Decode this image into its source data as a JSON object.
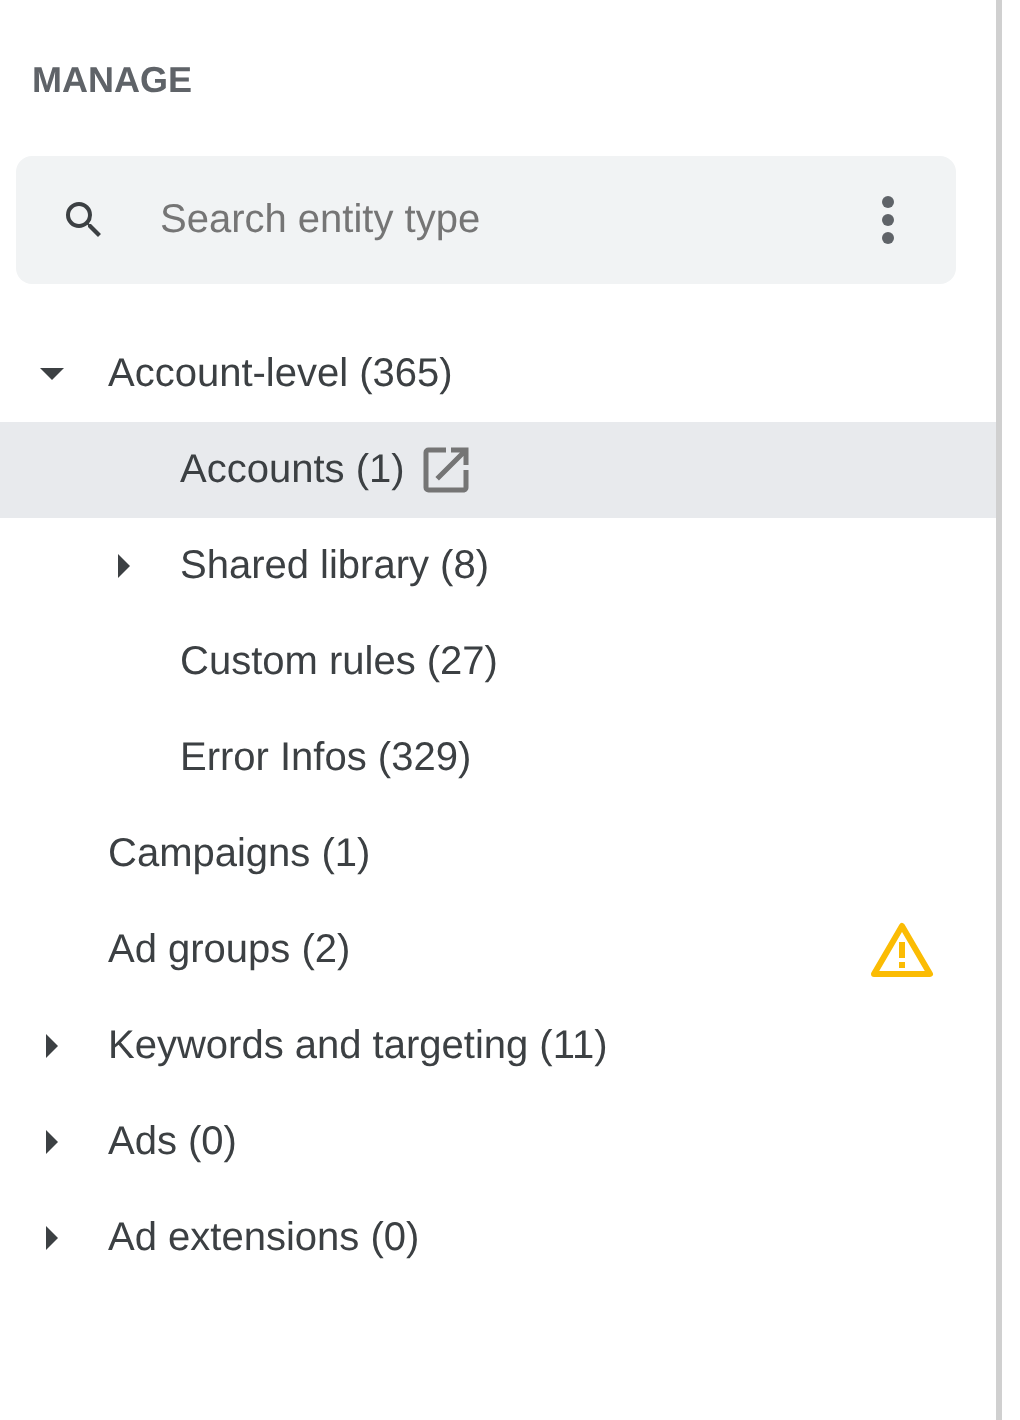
{
  "heading": "MANAGE",
  "search": {
    "placeholder": "Search entity type"
  },
  "tree": [
    {
      "label": "Account-level (365)",
      "kind": "folder",
      "expanded": true,
      "selected": false,
      "children": [
        {
          "label": "Accounts (1)",
          "kind": "leaf",
          "selected": true,
          "link": true
        },
        {
          "label": "Shared library (8)",
          "kind": "folder",
          "expanded": false,
          "selected": false
        },
        {
          "label": "Custom rules (27)",
          "kind": "leaf",
          "selected": false
        },
        {
          "label": "Error Infos (329)",
          "kind": "leaf",
          "selected": false
        }
      ]
    },
    {
      "label": "Campaigns (1)",
      "kind": "leaf",
      "selected": false
    },
    {
      "label": "Ad groups (2)",
      "kind": "leaf",
      "selected": false,
      "warning": true
    },
    {
      "label": "Keywords and targeting (11)",
      "kind": "folder",
      "expanded": false,
      "selected": false
    },
    {
      "label": "Ads (0)",
      "kind": "folder",
      "expanded": false,
      "selected": false
    },
    {
      "label": "Ad extensions (0)",
      "kind": "folder",
      "expanded": false,
      "selected": false
    }
  ]
}
